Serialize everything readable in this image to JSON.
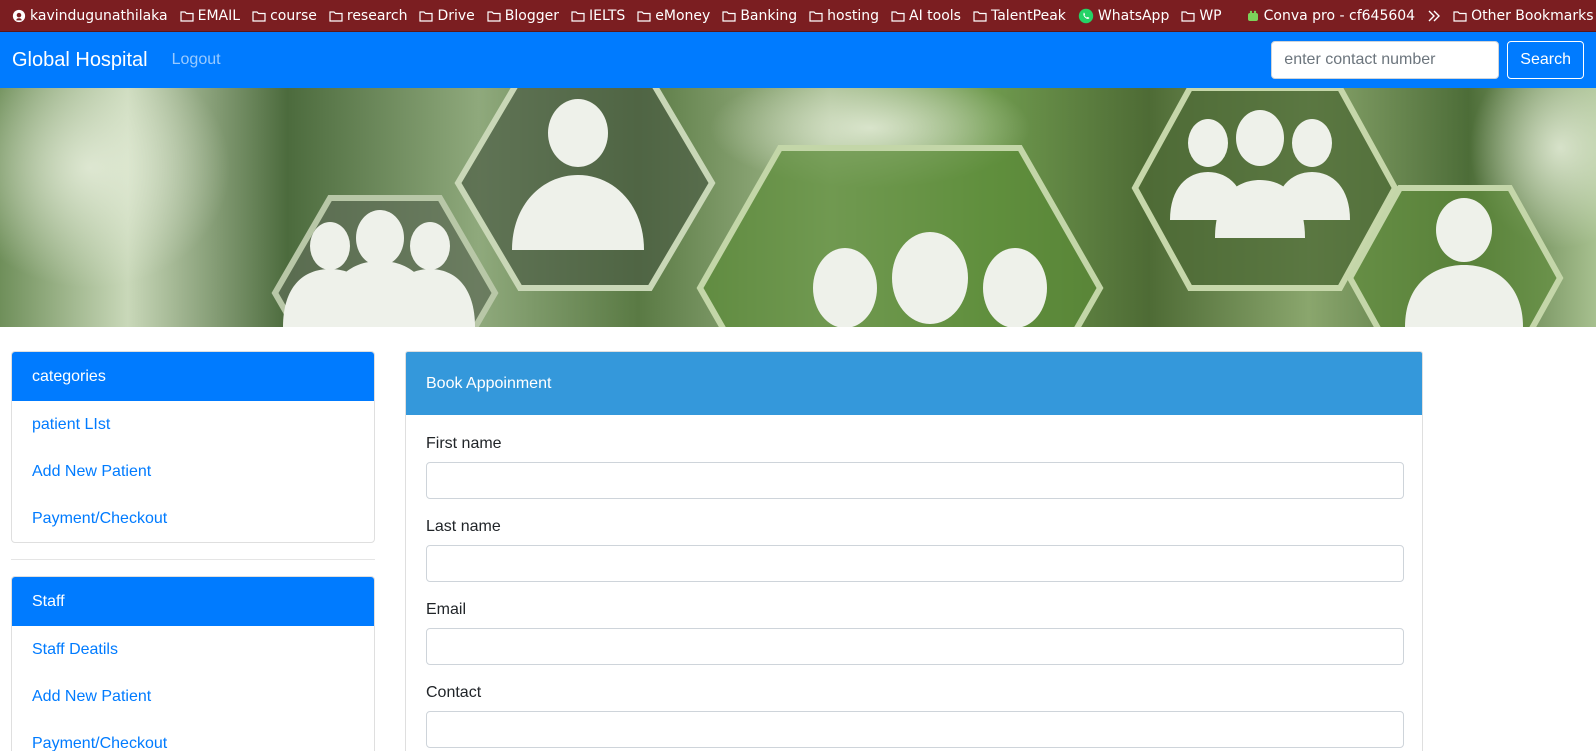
{
  "bookmarks": {
    "items": [
      {
        "label": "kavindugunathilaka",
        "icon": "github-icon"
      },
      {
        "label": "EMAIL",
        "icon": "folder-icon"
      },
      {
        "label": "course",
        "icon": "folder-icon"
      },
      {
        "label": "research",
        "icon": "folder-icon"
      },
      {
        "label": "Drive",
        "icon": "folder-icon"
      },
      {
        "label": "Blogger",
        "icon": "folder-icon"
      },
      {
        "label": "IELTS",
        "icon": "folder-icon"
      },
      {
        "label": "eMoney",
        "icon": "folder-icon"
      },
      {
        "label": "Banking",
        "icon": "folder-icon"
      },
      {
        "label": "hosting",
        "icon": "folder-icon"
      },
      {
        "label": "AI tools",
        "icon": "folder-icon"
      },
      {
        "label": "TalentPeak",
        "icon": "folder-icon"
      },
      {
        "label": "WhatsApp",
        "icon": "whatsapp-icon"
      },
      {
        "label": "WP",
        "icon": "folder-icon"
      },
      {
        "label": "Conva pro - cf645604",
        "icon": "android-icon"
      }
    ],
    "overflow_icon": "double-chevron-right-icon",
    "other": {
      "label": "Other Bookmarks",
      "icon": "folder-icon"
    }
  },
  "navbar": {
    "brand": "Global Hospital",
    "logout": "Logout",
    "search_placeholder": "enter contact number",
    "search_button": "Search"
  },
  "sidebar": {
    "categories": {
      "title": "categories",
      "items": [
        "patient LIst",
        "Add New Patient",
        "Payment/Checkout"
      ]
    },
    "staff": {
      "title": "Staff",
      "items": [
        "Staff Deatils",
        "Add New Patient",
        "Payment/Checkout"
      ]
    }
  },
  "form": {
    "title": "Book Appoinment",
    "fields": [
      {
        "label": "First name"
      },
      {
        "label": "Last name"
      },
      {
        "label": "Email"
      },
      {
        "label": "Contact"
      }
    ]
  },
  "colors": {
    "bookmark_bar": "#7b1e21",
    "navbar": "#007bff",
    "form_header": "#3498db",
    "link": "#007bff"
  }
}
